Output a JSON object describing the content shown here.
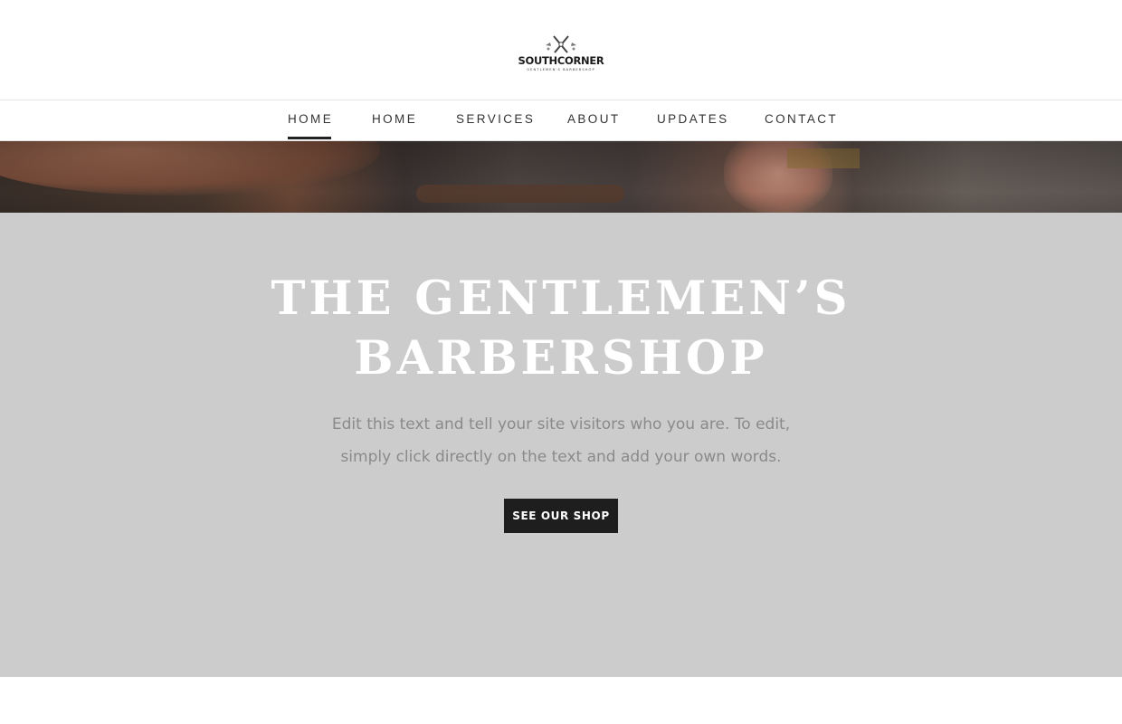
{
  "header": {
    "logo": {
      "name": "SOUTHCORNER",
      "tagline": "GENTLEMEN'S BARBERSHOP",
      "emblem_icon": "crossed-razors-icon"
    }
  },
  "nav": {
    "items": [
      {
        "label": "HOME",
        "active": true
      },
      {
        "label": "HOME",
        "active": false
      },
      {
        "label": "SERVICES",
        "active": false
      },
      {
        "label": "ABOUT",
        "active": false
      },
      {
        "label": "UPDATES",
        "active": false
      },
      {
        "label": "CONTACT",
        "active": false
      }
    ]
  },
  "hero": {
    "title_line1": "THE GENTLEMEN’S",
    "title_line2": "BARBERSHOP",
    "text_line1": "Edit this text and tell your site visitors who you are. To edit,",
    "text_line2": "simply click directly on the text and add your own words.",
    "button_label": "SEE OUR SHOP"
  },
  "colors": {
    "hero_background": "#cccccc",
    "button_background": "#1e1e1e",
    "nav_text": "#333333",
    "hero_title": "#ffffff",
    "hero_text": "#8a8a8a"
  }
}
